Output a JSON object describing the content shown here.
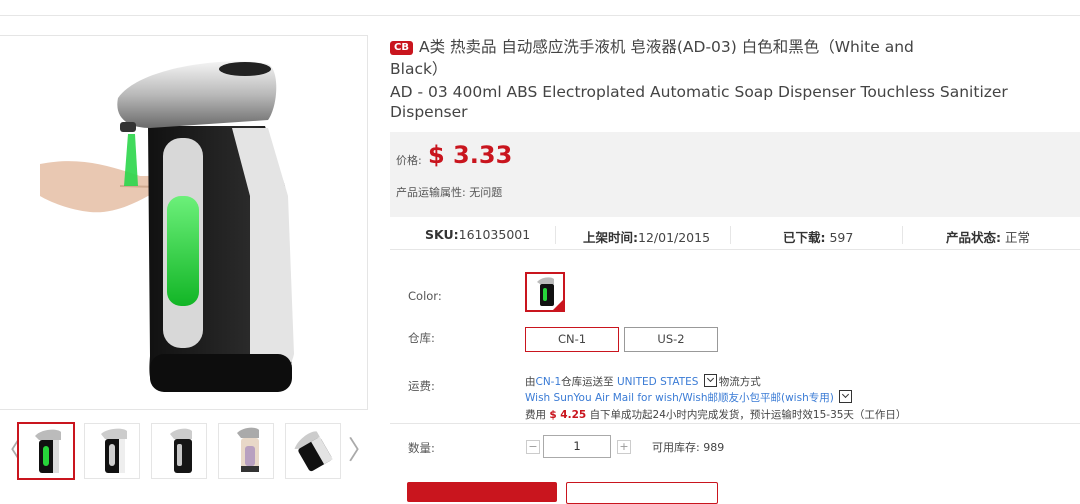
{
  "product": {
    "badge": "CB",
    "title_cn": "A类 热卖品 自动感应洗手液机 皂液器(AD-03) 白色和黑色（White and Black）",
    "title_en": "AD - 03 400ml ABS Electroplated Automatic Soap Dispenser Touchless Sanitizer Dispenser"
  },
  "price": {
    "label": "价格:",
    "value": "$ 3.33",
    "shipping_attr": "产品运输属性: 无问题"
  },
  "stats": {
    "sku_label": "SKU:",
    "sku_value": "161035001",
    "listed_label": "上架时间:",
    "listed_value": "12/01/2015",
    "downloads_label": "已下载:",
    "downloads_value": "597",
    "status_label": "产品状态:",
    "status_value": "正常"
  },
  "options": {
    "color_label": "Color:",
    "warehouse_label": "仓库:",
    "warehouses": [
      "CN-1",
      "US-2"
    ],
    "shipping_label": "运费:",
    "ship_from_prefix": "由",
    "ship_from": "CN-1",
    "ship_mid": "仓库运送至",
    "ship_to": "UNITED STATES",
    "ship_method_label": "物流方式",
    "carrier": "Wish SunYou Air Mail for wish/Wish邮顺友小包平邮(wish专用)",
    "fee_prefix": "费用",
    "fee_value": "$ 4.25",
    "fee_suffix": "自下单成功起24小时内完成发货，预计运输时效15-35天（工作日）",
    "qty_label": "数量:",
    "qty_minus": "−",
    "qty_value": "1",
    "qty_plus": "+",
    "stock_label": "可用库存: 989"
  },
  "gallery": {
    "prev": "〈",
    "next": "〉"
  },
  "colors": {
    "accent": "#c9151e",
    "link": "#3a7bd5",
    "dispenser_green": "#27d63a"
  }
}
